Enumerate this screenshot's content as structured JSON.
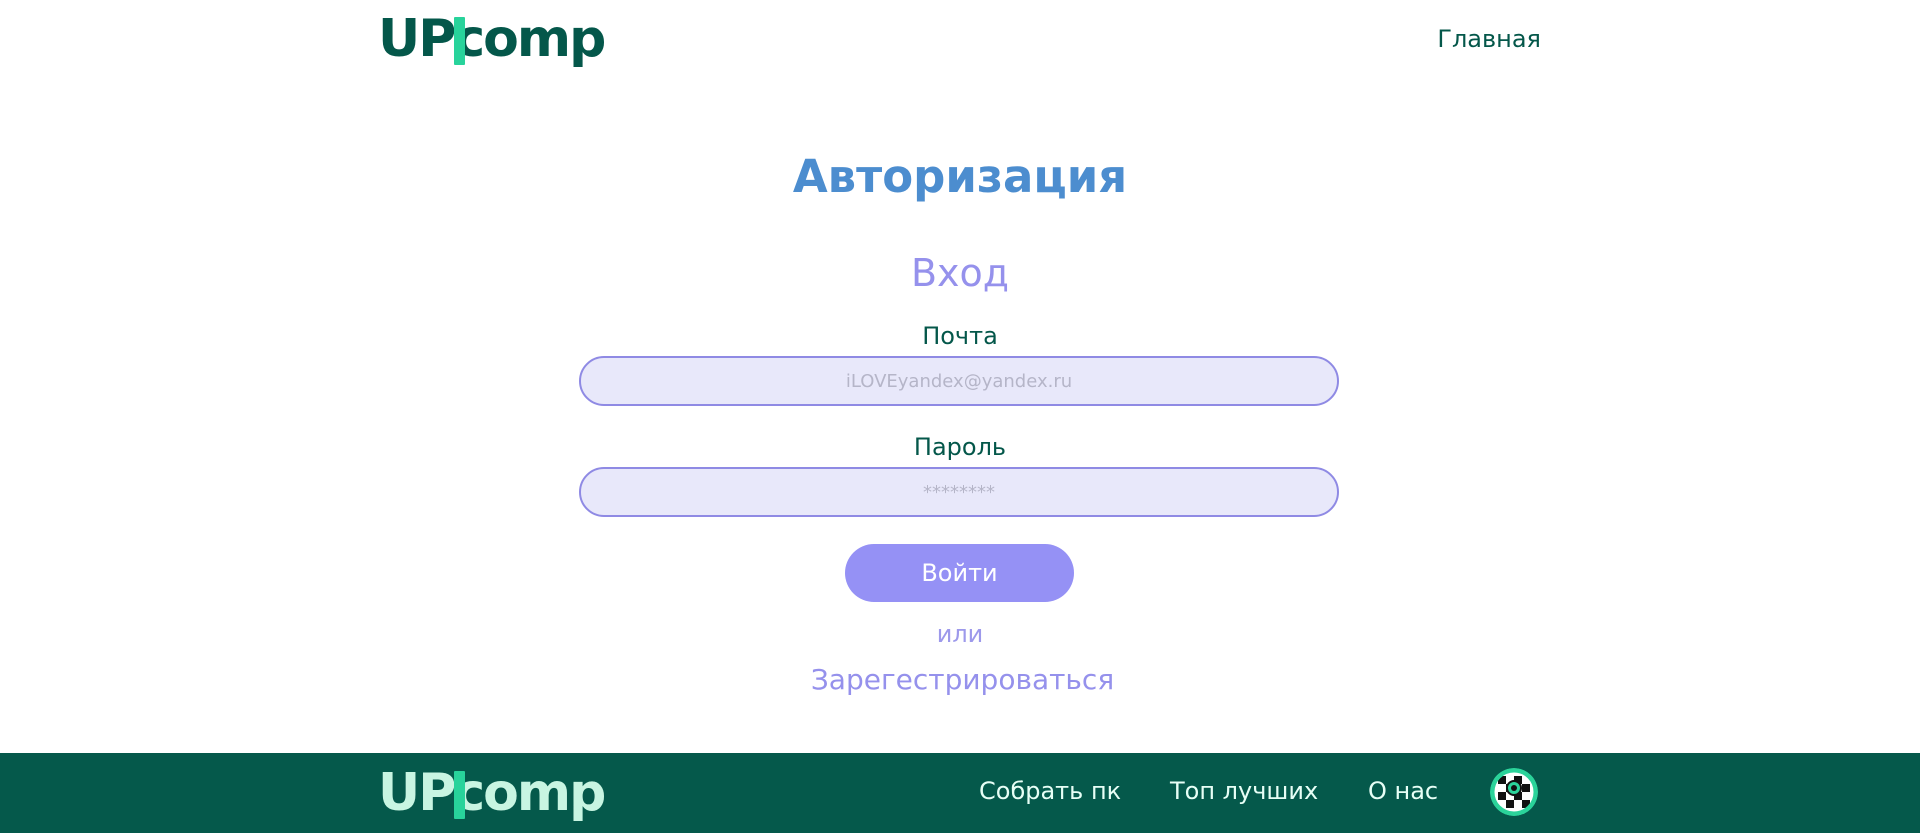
{
  "header": {
    "logo": {
      "part1": "U",
      "part2": "P",
      "part3": "comp"
    },
    "nav_home": "Главная"
  },
  "main": {
    "title": "Авторизация",
    "form_title": "Вход",
    "email": {
      "label": "Почта",
      "placeholder": "iLOVEyandex@yandex.ru"
    },
    "password": {
      "label": "Пароль",
      "placeholder": "********"
    },
    "login_button": "Войти",
    "or_text": "или",
    "register_link": "Зарегестрироваться"
  },
  "footer": {
    "logo": {
      "part1": "U",
      "part2": "P",
      "part3": "comp"
    },
    "nav": {
      "build": "Собрать пк",
      "top": "Топ лучших",
      "about": "О нас"
    },
    "avatar_icon": "checkered-avatar-icon"
  },
  "colors": {
    "brand_dark_green": "#04574a",
    "brand_light_green": "#28d39b",
    "title_blue": "#4c8dcf",
    "accent_violet": "#9591f5",
    "input_bg": "#e8e8fa"
  }
}
